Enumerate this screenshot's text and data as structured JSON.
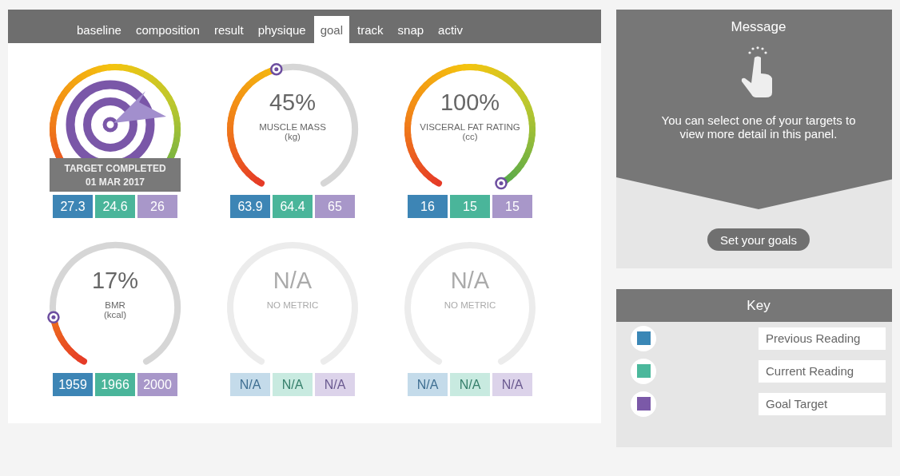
{
  "tabs": [
    {
      "label": "baseline",
      "selected": false
    },
    {
      "label": "composition",
      "selected": false
    },
    {
      "label": "result",
      "selected": false
    },
    {
      "label": "physique",
      "selected": false
    },
    {
      "label": "goal",
      "selected": true
    },
    {
      "label": "track",
      "selected": false
    },
    {
      "label": "snap",
      "selected": false
    },
    {
      "label": "activ",
      "selected": false
    }
  ],
  "gauges": [
    {
      "kind": "completed",
      "banner": [
        "TARGET COMPLETED",
        "01 MAR 2017"
      ],
      "readings": [
        "27.3",
        "24.6",
        "26"
      ]
    },
    {
      "kind": "progress",
      "percent": "45%",
      "metric": "MUSCLE MASS",
      "unit": "(kg)",
      "readings": [
        "63.9",
        "64.4",
        "65"
      ]
    },
    {
      "kind": "progress",
      "percent": "100%",
      "metric": "VISCERAL FAT RATING",
      "unit": "(cc)",
      "readings": [
        "16",
        "15",
        "15"
      ]
    },
    {
      "kind": "progress",
      "percent": "17%",
      "metric": "BMR",
      "unit": "(kcal)",
      "readings": [
        "1959",
        "1966",
        "2000"
      ]
    },
    {
      "kind": "none",
      "percent": "N/A",
      "metric": "NO METRIC",
      "readings": [
        "N/A",
        "N/A",
        "N/A"
      ]
    },
    {
      "kind": "none",
      "percent": "N/A",
      "metric": "NO METRIC",
      "readings": [
        "N/A",
        "N/A",
        "N/A"
      ]
    }
  ],
  "message": {
    "title": "Message",
    "text": "You can select one of your targets to view more detail in this panel.",
    "button": "Set your goals"
  },
  "key": {
    "title": "Key",
    "items": [
      {
        "label": "Previous Reading",
        "color": "#3a87b6"
      },
      {
        "label": "Current Reading",
        "color": "#4bb89c"
      },
      {
        "label": "Goal Target",
        "color": "#7b59a8"
      }
    ]
  }
}
